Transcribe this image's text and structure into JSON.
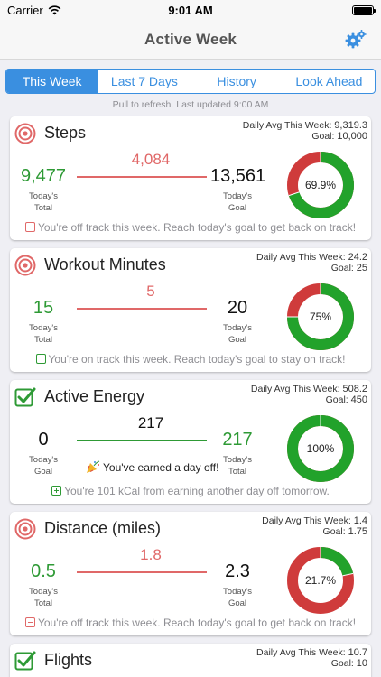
{
  "status_bar": {
    "carrier": "Carrier",
    "time": "9:01 AM"
  },
  "nav": {
    "title": "Active Week",
    "settings_icon": "gears-icon"
  },
  "tabs": [
    {
      "label": "This Week",
      "active": true
    },
    {
      "label": "Last 7 Days",
      "active": false
    },
    {
      "label": "History",
      "active": false
    },
    {
      "label": "Look Ahead",
      "active": false
    }
  ],
  "refresh_note": "Pull to refresh.  Last updated 9:00 AM",
  "colors": {
    "accent": "#3a8fe0",
    "green": "#2e9a35",
    "red": "#e06868",
    "donut_red": "#cf3b3b",
    "donut_green": "#22a22b"
  },
  "cards": [
    {
      "title": "Steps",
      "status": "off",
      "avg_label": "Daily Avg This Week:",
      "avg_value": "9,319.3",
      "goal_label": "Goal:",
      "goal_value": "10,000",
      "left_value": "9,477",
      "left_sub1": "Today's",
      "left_sub2": "Total",
      "mid_value": "4,084",
      "right_value": "13,561",
      "right_sub1": "Today's",
      "right_sub2": "Goal",
      "percent_label": "69.9%",
      "percent": 69.9,
      "message": "You're off track this week.  Reach today's goal to get back on track!"
    },
    {
      "title": "Workout Minutes",
      "status": "on",
      "avg_label": "Daily Avg This Week:",
      "avg_value": "24.2",
      "goal_label": "Goal:",
      "goal_value": "25",
      "left_value": "15",
      "left_sub1": "Today's",
      "left_sub2": "Total",
      "mid_value": "5",
      "right_value": "20",
      "right_sub1": "Today's",
      "right_sub2": "Goal",
      "percent_label": "75%",
      "percent": 75,
      "message": "You're on track this week.  Reach today's goal to stay on track!"
    },
    {
      "title": "Active Energy",
      "status": "done",
      "avg_label": "Daily Avg This Week:",
      "avg_value": "508.2",
      "goal_label": "Goal:",
      "goal_value": "450",
      "left_value": "0",
      "left_sub1": "Today's",
      "left_sub2": "Goal",
      "mid_value": "217",
      "right_value": "217",
      "right_sub1": "Today's",
      "right_sub2": "Total",
      "percent_label": "100%",
      "percent": 100,
      "earned": "You've earned a day off!",
      "message": "You're 101 kCal from earning another day off tomorrow."
    },
    {
      "title": "Distance (miles)",
      "status": "off",
      "avg_label": "Daily Avg This Week:",
      "avg_value": "1.4",
      "goal_label": "Goal:",
      "goal_value": "1.75",
      "left_value": "0.5",
      "left_sub1": "Today's",
      "left_sub2": "Total",
      "mid_value": "1.8",
      "right_value": "2.3",
      "right_sub1": "Today's",
      "right_sub2": "Goal",
      "percent_label": "21.7%",
      "percent": 21.7,
      "message": "You're off track this week.  Reach today's goal to get back on track!"
    },
    {
      "title": "Flights",
      "status": "done",
      "avg_label": "Daily Avg This Week:",
      "avg_value": "10.7",
      "goal_label": "Goal:",
      "goal_value": "10"
    }
  ]
}
